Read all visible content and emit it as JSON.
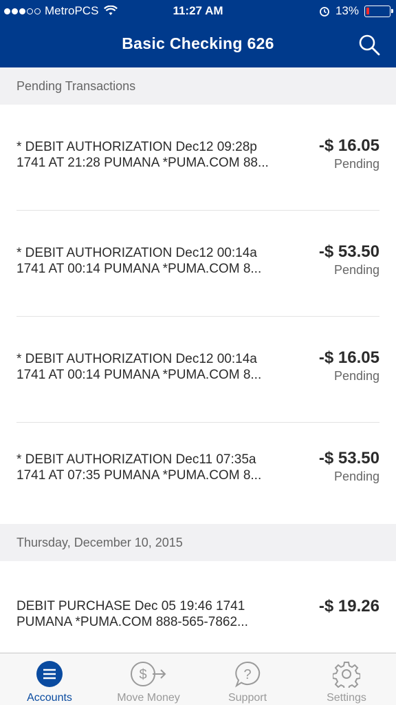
{
  "status_bar": {
    "carrier": "MetroPCS",
    "time": "11:27 AM",
    "battery_percent": "13%",
    "battery_level": 0.13
  },
  "header": {
    "title": "Basic Checking 626",
    "search_icon": "search-icon"
  },
  "sections": [
    {
      "label": "Pending Transactions",
      "transactions": [
        {
          "line1": "* DEBIT AUTHORIZATION Dec12 09:28p",
          "line2": "1741 AT 21:28 PUMANA *PUMA.COM 88...",
          "amount": "-$ 16.05",
          "status": "Pending"
        },
        {
          "line1": "* DEBIT AUTHORIZATION Dec12 00:14a",
          "line2": "1741 AT 00:14 PUMANA *PUMA.COM 8...",
          "amount": "-$ 53.50",
          "status": "Pending"
        },
        {
          "line1": "* DEBIT AUTHORIZATION Dec12 00:14a",
          "line2": "1741 AT 00:14 PUMANA *PUMA.COM 8...",
          "amount": "-$ 16.05",
          "status": "Pending"
        },
        {
          "line1": "* DEBIT AUTHORIZATION Dec11 07:35a",
          "line2": "1741 AT 07:35 PUMANA *PUMA.COM 8...",
          "amount": "-$ 53.50",
          "status": "Pending"
        }
      ]
    },
    {
      "label": "Thursday, December 10, 2015",
      "transactions": [
        {
          "line1": "DEBIT PURCHASE Dec 05 19:46 1741",
          "line2": "PUMANA *PUMA.COM 888-565-7862...",
          "amount": "-$ 19.26",
          "status": ""
        }
      ]
    }
  ],
  "tabs": [
    {
      "label": "Accounts",
      "icon": "menu-icon",
      "active": true
    },
    {
      "label": "Move Money",
      "icon": "transfer-icon",
      "active": false
    },
    {
      "label": "Support",
      "icon": "help-icon",
      "active": false
    },
    {
      "label": "Settings",
      "icon": "gear-icon",
      "active": false
    }
  ],
  "colors": {
    "header": "#003a8c",
    "active_tab": "#0a4ba0",
    "battery_low": "#ff2a2a"
  }
}
